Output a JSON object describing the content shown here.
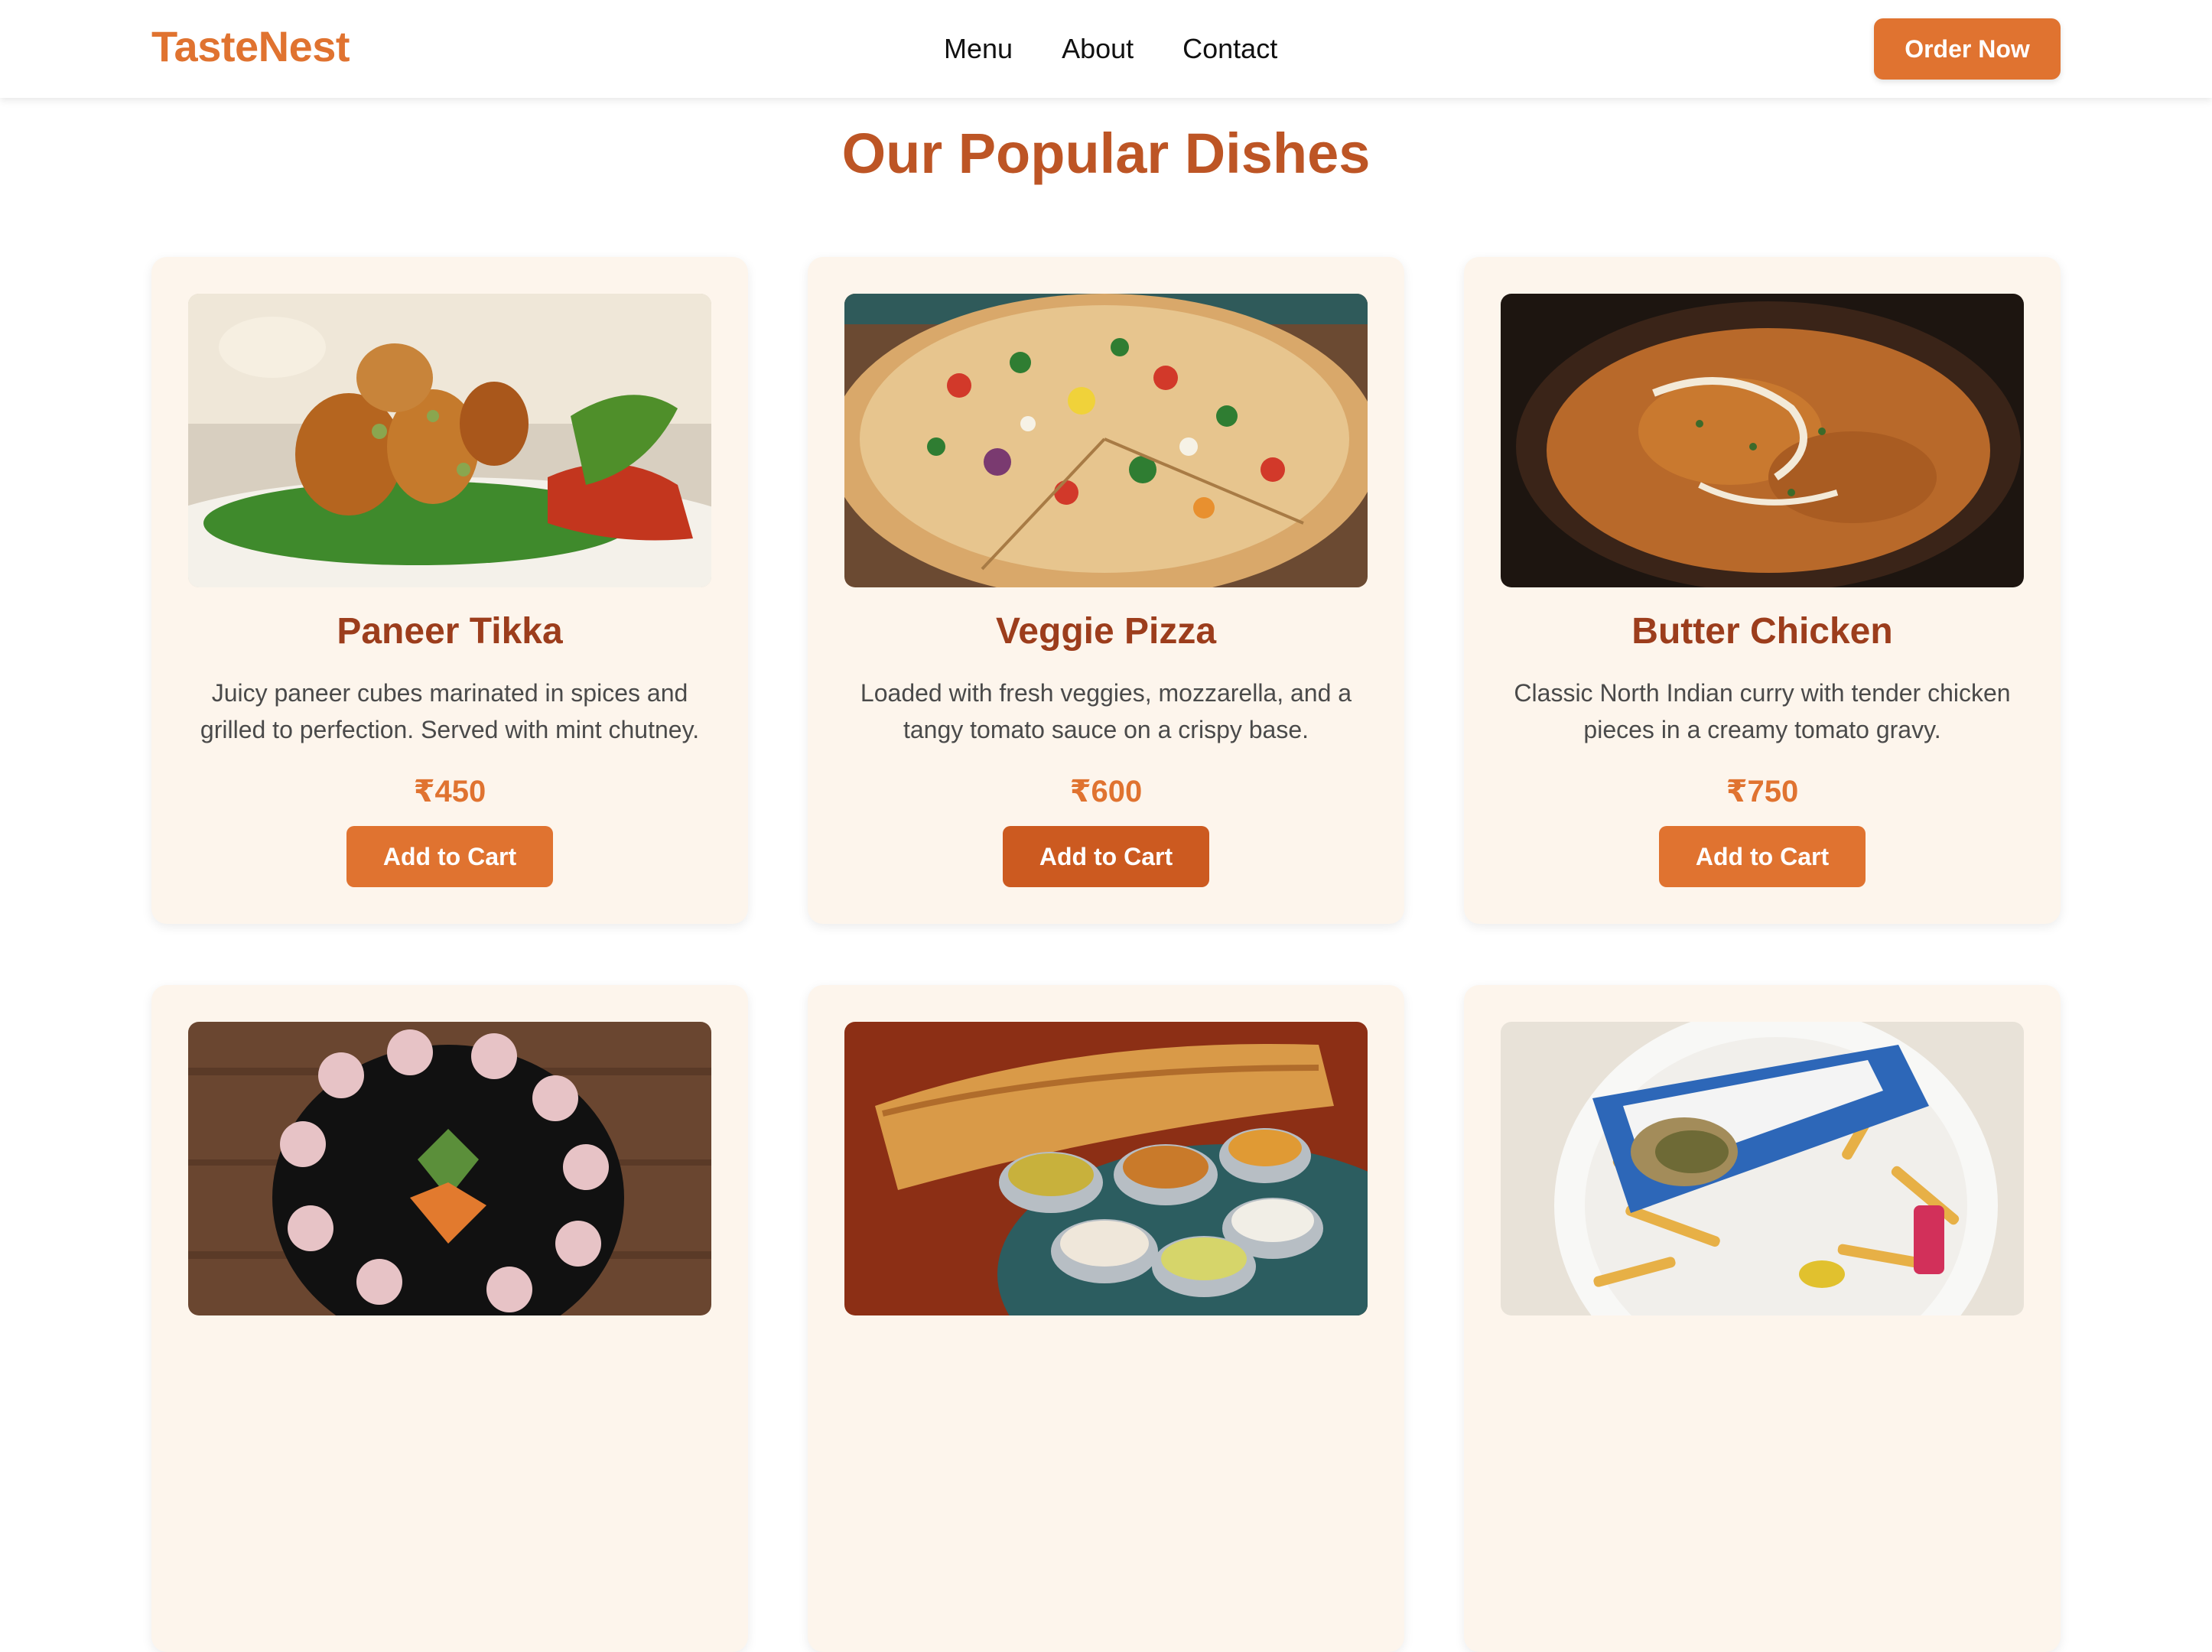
{
  "brand": {
    "name": "TasteNest",
    "color": "#e07330"
  },
  "nav": {
    "links": [
      "Menu",
      "About",
      "Contact"
    ],
    "cta_label": "Order Now"
  },
  "section": {
    "title": "Our Popular Dishes"
  },
  "dishes": [
    {
      "name": "Paneer Tikka",
      "description": "Juicy paneer cubes marinated in spices and grilled to perfection. Served with mint chutney.",
      "price": "₹450",
      "button_label": "Add to Cart",
      "image": "paneer-tikka-photo"
    },
    {
      "name": "Veggie Pizza",
      "description": "Loaded with fresh veggies, mozzarella, and a tangy tomato sauce on a crispy base.",
      "price": "₹600",
      "button_label": "Add to Cart",
      "image": "veggie-pizza-photo"
    },
    {
      "name": "Butter Chicken",
      "description": "Classic North Indian curry with tender chicken pieces in a creamy tomato gravy.",
      "price": "₹750",
      "button_label": "Add to Cart",
      "image": "butter-chicken-photo"
    },
    {
      "image": "sushi-platter-photo"
    },
    {
      "image": "masala-dosa-photo"
    },
    {
      "image": "wrap-with-fries-photo"
    }
  ],
  "colors": {
    "accent": "#e07330",
    "title": "#bd5525",
    "dish_name": "#9c3d1c",
    "card_bg": "#fdf5ec"
  }
}
